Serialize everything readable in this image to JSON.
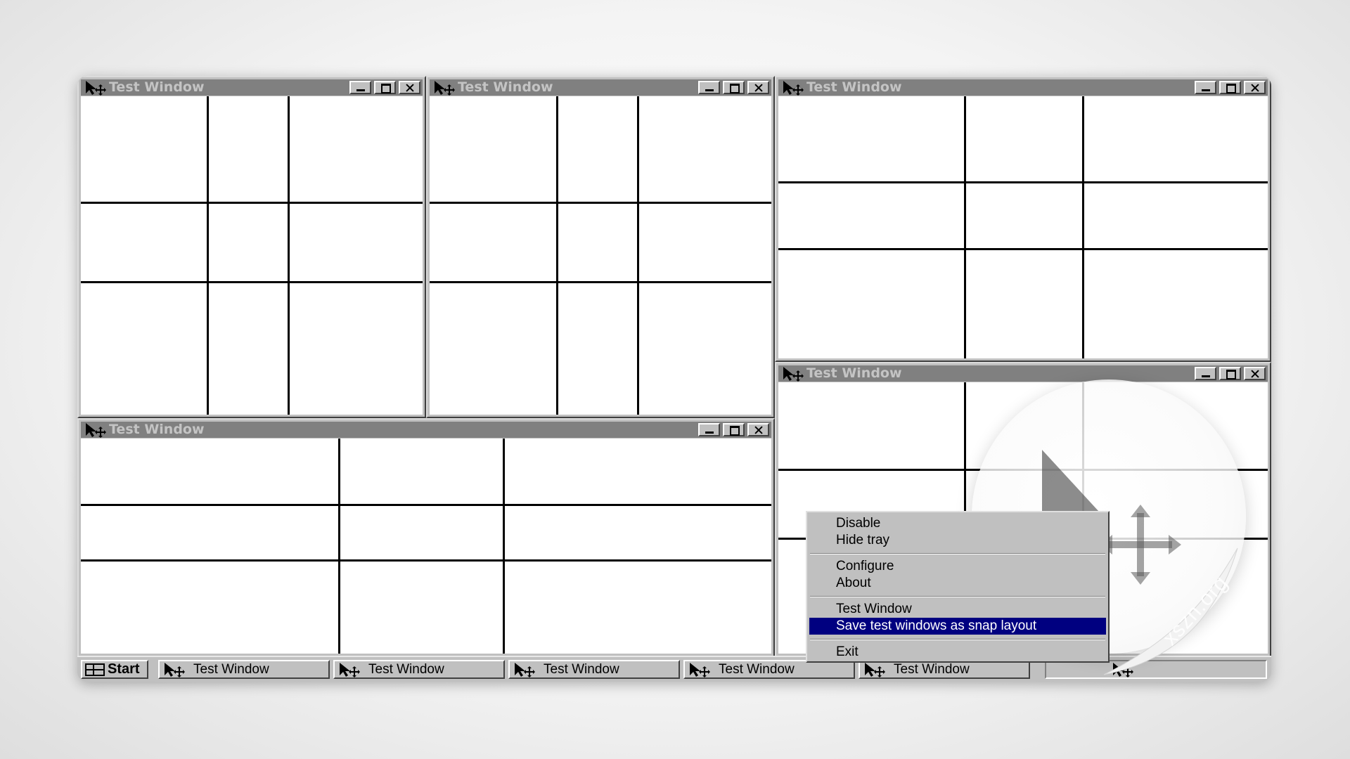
{
  "window_title": "Test Window",
  "windows": [
    {
      "id": "w1",
      "title": "Test Window"
    },
    {
      "id": "w2",
      "title": "Test Window"
    },
    {
      "id": "w3",
      "title": "Test Window"
    },
    {
      "id": "w4",
      "title": "Test Window"
    },
    {
      "id": "w5",
      "title": "Test Window"
    }
  ],
  "taskbar": {
    "start_label": "Start",
    "tasks": [
      "Test Window",
      "Test Window",
      "Test Window",
      "Test Window",
      "Test Window"
    ]
  },
  "context_menu": {
    "items": [
      {
        "label": "Disable",
        "hotkey": "D"
      },
      {
        "label": "Hide tray",
        "hotkey": "H"
      },
      {
        "label": "Configure",
        "hotkey": "C"
      },
      {
        "label": "About",
        "hotkey": "A"
      },
      {
        "label": "Test Window",
        "hotkey": "W"
      },
      {
        "label": "Save test windows as snap layout",
        "hotkey": "S",
        "selected": true
      },
      {
        "label": "Exit",
        "hotkey": "x"
      }
    ]
  },
  "watermark": "xszn.org",
  "colors": {
    "titlebar_inactive": "#808080",
    "title_text": "#c4c4c4",
    "menu_highlight": "#000080",
    "window_face": "#c0c0c0"
  },
  "icons": {
    "app": "move-cursor-icon",
    "start": "windows-logo-icon",
    "minimize": "minimize-icon",
    "maximize": "maximize-icon",
    "close": "close-icon"
  }
}
